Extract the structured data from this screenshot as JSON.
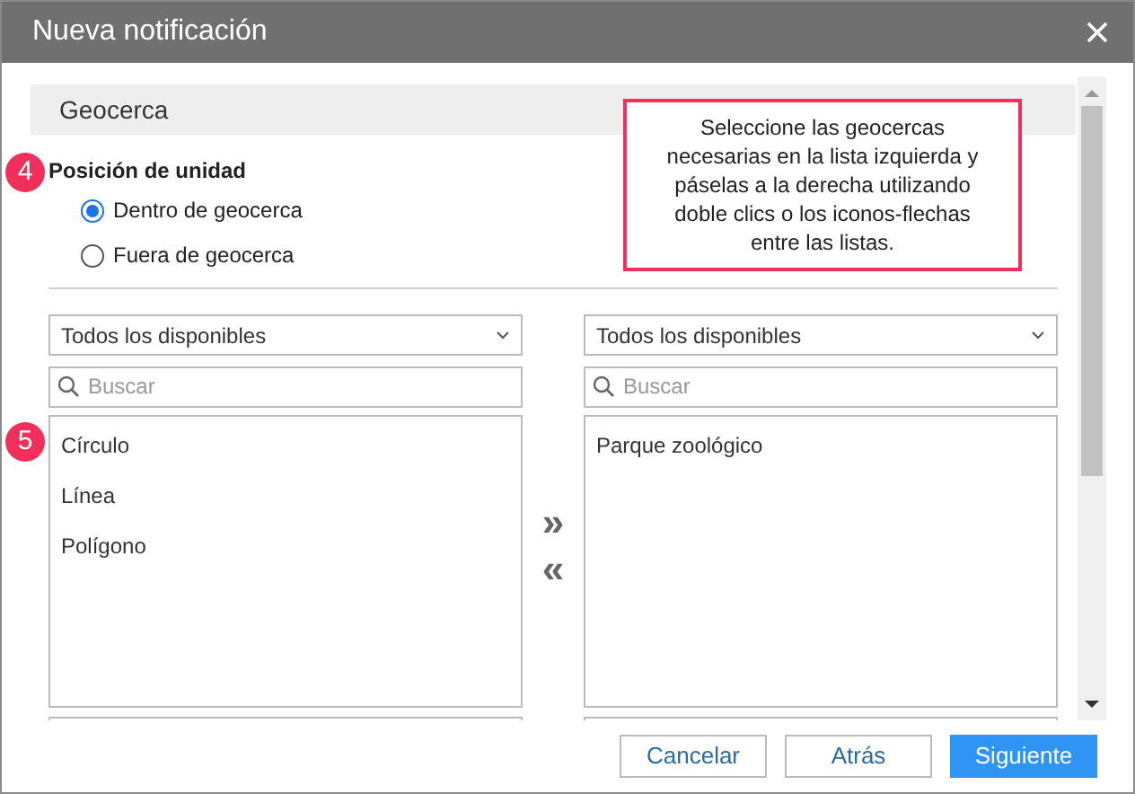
{
  "window": {
    "title": "Nueva notificación"
  },
  "section": {
    "title": "Geocerca"
  },
  "callout": {
    "text": "Seleccione las geocercas necesarias en la lista izquierda y páselas a la derecha utilizando doble clics o los iconos-flechas entre las listas."
  },
  "unit_position": {
    "badge": "4",
    "label": "Posición de unidad",
    "options": [
      {
        "label": "Dentro de geocerca",
        "selected": true
      },
      {
        "label": "Fuera de geocerca",
        "selected": false
      }
    ]
  },
  "lists": {
    "badge": "5",
    "left": {
      "filter": "Todos los disponibles",
      "search_placeholder": "Buscar",
      "items": [
        "Círculo",
        "Línea",
        "Polígono"
      ]
    },
    "right": {
      "filter": "Todos los disponibles",
      "search_placeholder": "Buscar",
      "items": [
        "Parque zoológico"
      ]
    }
  },
  "transfer": {
    "add": "»",
    "remove": "«"
  },
  "buttons": [
    {
      "label": "Cancelar",
      "kind": "secondary"
    },
    {
      "label": "Atrás",
      "kind": "secondary"
    },
    {
      "label": "Siguiente",
      "kind": "primary"
    }
  ]
}
